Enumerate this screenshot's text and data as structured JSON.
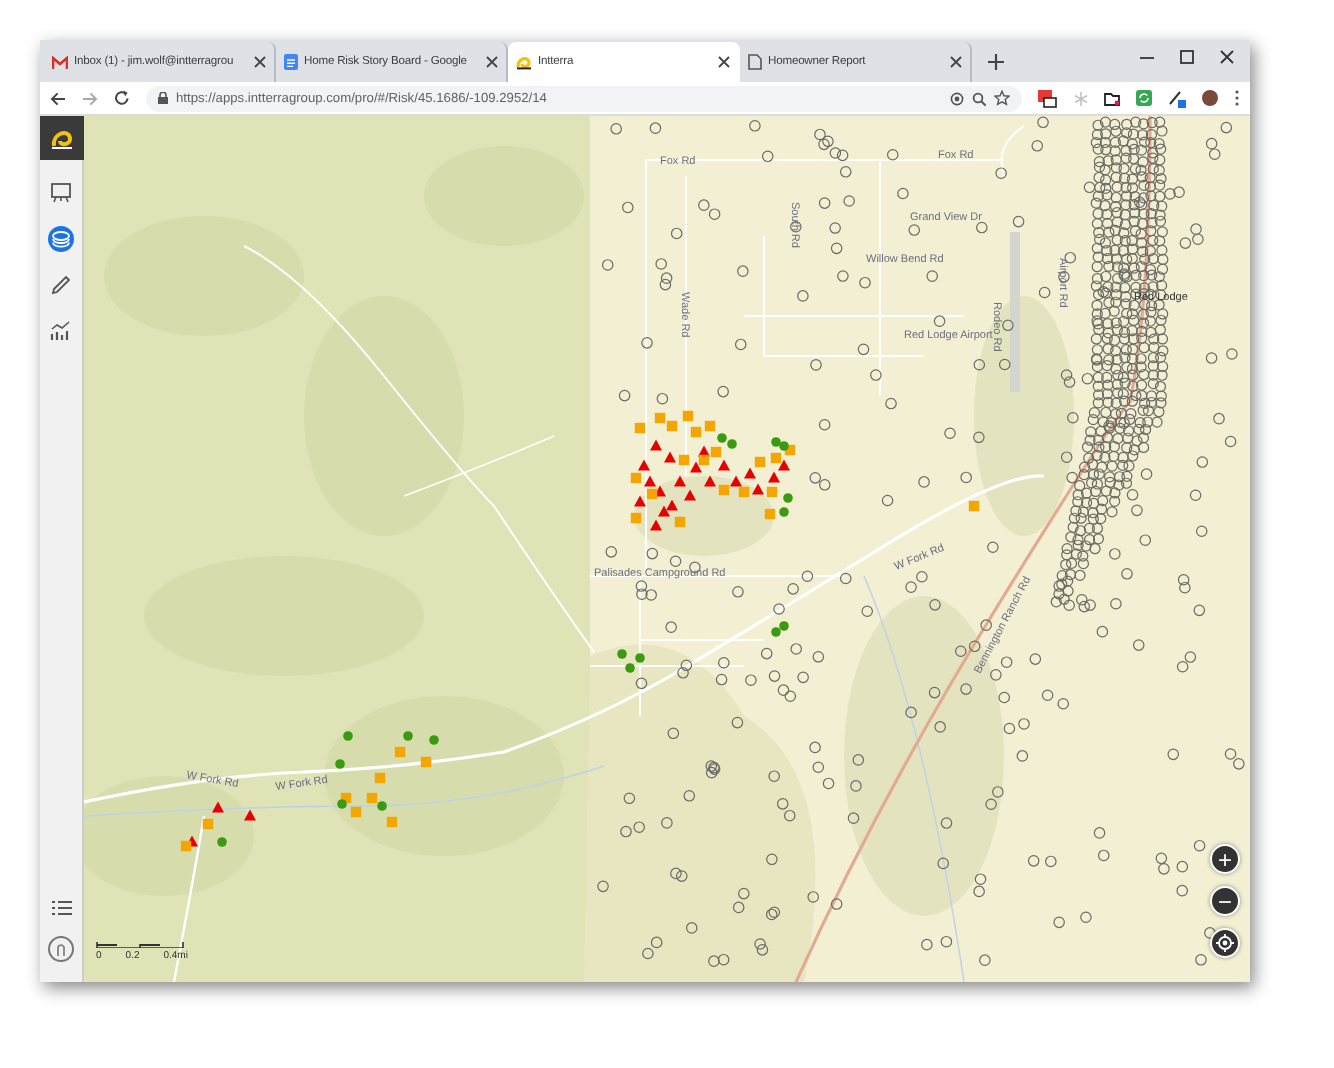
{
  "tabs": [
    {
      "title": "Inbox (1) - jim.wolf@intterragrou",
      "selected": false
    },
    {
      "title": "Home Risk Story Board - Google",
      "selected": false
    },
    {
      "title": "Intterra",
      "selected": true
    },
    {
      "title": "Homeowner Report",
      "selected": false
    }
  ],
  "address_bar": {
    "url": "https://apps.intterragroup.com/pro/#/Risk/45.1686/-109.2952/14"
  },
  "sidebar": {
    "items": [
      {
        "selected": false
      },
      {
        "selected": true
      },
      {
        "selected": false
      },
      {
        "selected": false
      }
    ]
  },
  "map": {
    "labels": [
      "Fox Rd",
      "Fox Rd",
      "Grand View Dr",
      "Willow Bend Rd",
      "South Rd",
      "Wade Rd",
      "Airport Rd",
      "Red Lodge",
      "Red Lodge Airport",
      "Rodeo Rd",
      "W Fork Rd",
      "Palisades Campground Rd",
      "W Fork Rd",
      "W Fork Rd",
      "Bennington Ranch Rd"
    ],
    "scale_bar": {
      "ticks": [
        "0",
        "0.2",
        "0.4mi"
      ]
    },
    "zoom_in": "+",
    "zoom_out": "−"
  }
}
